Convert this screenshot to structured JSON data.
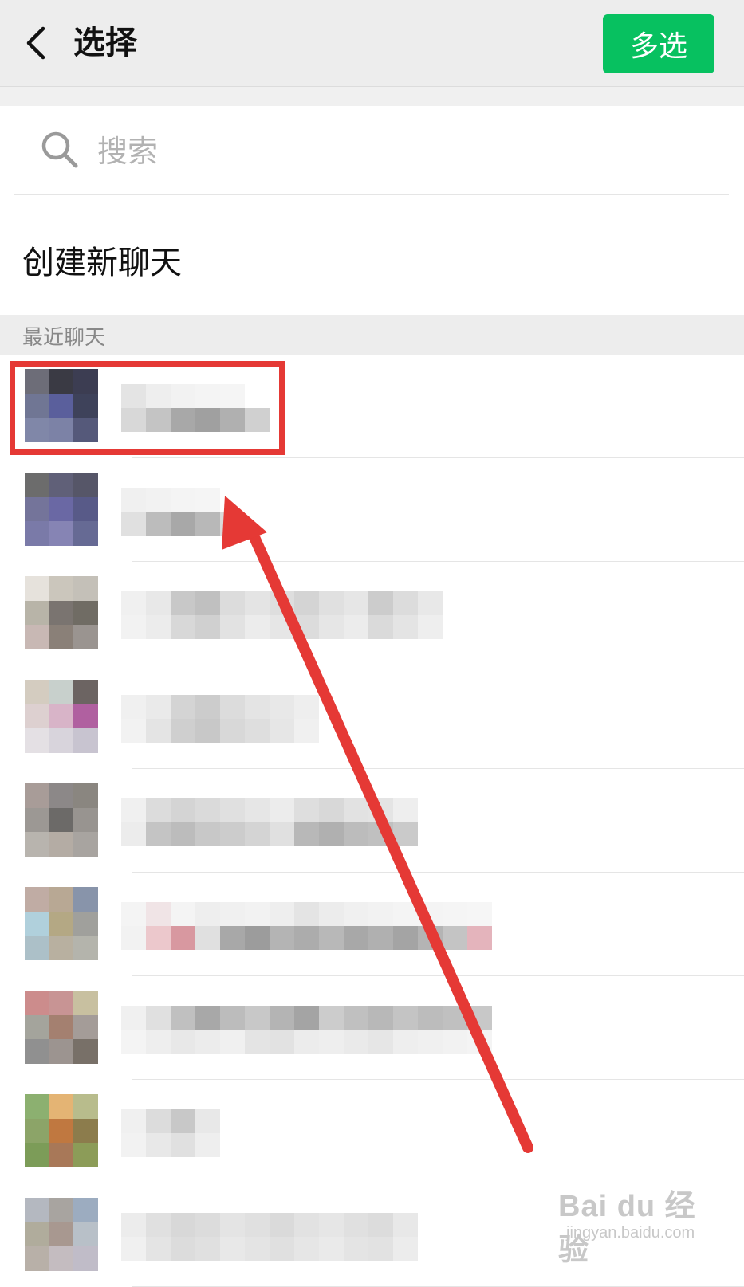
{
  "header": {
    "title": "选择",
    "multi_select_label": "多选"
  },
  "search": {
    "placeholder": "搜索"
  },
  "create_chat_label": "创建新聊天",
  "recent_section_label": "最近聊天",
  "colors": {
    "accent_green": "#07c160",
    "header_bg": "#ededed",
    "highlight_red": "#e53935"
  },
  "watermark": {
    "main": "Bai du 经验",
    "sub": "jingyan.baidu.com"
  },
  "chats": [
    {
      "avatar": [
        "#6d6d78",
        "#3a3a44",
        "#3c3d52",
        "#707694",
        "#5a5f9c",
        "#3e425a",
        "#8087a8",
        "#7c82a6",
        "#55597a"
      ],
      "name_rows": [
        [
          "#e4e4e4",
          "#eeeeee",
          "#f2f2f2",
          "#f4f4f4",
          "#f5f5f5"
        ],
        [
          "#d8d8d8",
          "#c4c4c4",
          "#a8a8a8",
          "#a0a0a0",
          "#b0b0b0",
          "#d0d0d0"
        ]
      ]
    },
    {
      "avatar": [
        "#6c6c6c",
        "#606078",
        "#565668",
        "#74749a",
        "#6a68a4",
        "#585a88",
        "#7a7aa8",
        "#8684b4",
        "#666a94"
      ],
      "name_rows": [
        [
          "#f0f0f0",
          "#f2f2f2",
          "#f4f4f4",
          "#f5f5f5"
        ],
        [
          "#e0e0e0",
          "#bcbcbc",
          "#a8a8a8",
          "#b8b8b8",
          "#dadada"
        ]
      ]
    },
    {
      "avatar": [
        "#e6e2dc",
        "#cbc6bc",
        "#c4c0b8",
        "#b8b4a8",
        "#7a7470",
        "#706c64",
        "#c8b8b4",
        "#8a8078",
        "#9a9490"
      ],
      "name_rows": [
        [
          "#f0f0f0",
          "#e8e8e8",
          "#c8c8c8",
          "#c0c0c0",
          "#dcdcdc",
          "#e4e4e4",
          "#dedede",
          "#d4d4d4",
          "#e0e0e0",
          "#e6e6e6",
          "#cccccc",
          "#dcdcdc",
          "#e8e8e8"
        ],
        [
          "#f2f2f2",
          "#ececec",
          "#d8d8d8",
          "#d0d0d0",
          "#e2e2e2",
          "#ececec",
          "#e6e6e6",
          "#dcdcdc",
          "#e6e6e6",
          "#ececec",
          "#dadada",
          "#e4e4e4",
          "#eeeeee"
        ]
      ]
    },
    {
      "avatar": [
        "#d4ccc0",
        "#c8d0cc",
        "#6c6462",
        "#ddd0d0",
        "#d8b4c8",
        "#b060a0",
        "#e4e0e4",
        "#d8d4dc",
        "#c8c4d0"
      ],
      "name_rows": [
        [
          "#f0f0f0",
          "#eaeaea",
          "#d4d4d4",
          "#cccccc",
          "#dcdcdc",
          "#e4e4e4",
          "#e8e8e8",
          "#eeeeee"
        ],
        [
          "#f2f2f2",
          "#e4e4e4",
          "#cfcfcf",
          "#c8c8c8",
          "#d8d8d8",
          "#dedede",
          "#e6e6e6",
          "#f0f0f0"
        ]
      ]
    },
    {
      "avatar": [
        "#a89c98",
        "#8c8888",
        "#8a8680",
        "#9c9894",
        "#6c6a68",
        "#989490",
        "#b8b4ae",
        "#b4aca4",
        "#a8a4a0"
      ],
      "name_rows": [
        [
          "#f0f0f0",
          "#dcdcdc",
          "#d4d4d4",
          "#dadada",
          "#e0e0e0",
          "#e6e6e6",
          "#ececec",
          "#dedede",
          "#d8d8d8",
          "#e2e2e2",
          "#e4e4e4",
          "#eeeeee"
        ],
        [
          "#ececec",
          "#c4c4c4",
          "#bcbcbc",
          "#c8c8c8",
          "#cccccc",
          "#d4d4d4",
          "#e0e0e0",
          "#b8b8b8",
          "#b0b0b0",
          "#bcbcbc",
          "#c0c0c0",
          "#cacaca"
        ]
      ]
    },
    {
      "avatar": [
        "#c0aca4",
        "#b8a894",
        "#8894aa",
        "#b0d0dc",
        "#b4a884",
        "#a0a09c",
        "#acc0c8",
        "#b8b0a0",
        "#b4b4ac"
      ],
      "name_rows": [
        [
          "#f4f4f4",
          "#f0e4e6",
          "#f4f4f4",
          "#eeeeee",
          "#f0f0f0",
          "#f2f2f2",
          "#eeeeee",
          "#e4e4e4",
          "#ececec",
          "#f0f0f0",
          "#f2f2f2",
          "#f4f4f4",
          "#f4f4f4",
          "#f5f5f5",
          "#f6f6f6"
        ],
        [
          "#f2f2f2",
          "#ecc8cc",
          "#d898a0",
          "#e0e0e0",
          "#a8a8a8",
          "#9c9c9c",
          "#b4b4b4",
          "#acacac",
          "#b8b8b8",
          "#a8a8a8",
          "#b0b0b0",
          "#a4a4a4",
          "#b4b4b4",
          "#c4c4c4",
          "#e4b4bc"
        ]
      ]
    },
    {
      "avatar": [
        "#cc8c8c",
        "#c89494",
        "#c8c0a0",
        "#a4a49c",
        "#a48070",
        "#a49c98",
        "#909090",
        "#9c9490",
        "#787068"
      ],
      "name_rows": [
        [
          "#f0f0f0",
          "#e0e0e0",
          "#c0c0c0",
          "#a8a8a8",
          "#bcbcbc",
          "#c8c8c8",
          "#b4b4b4",
          "#a4a4a4",
          "#cccccc",
          "#c0c0c0",
          "#b8b8b8",
          "#c4c4c4",
          "#bcbcbc",
          "#c0c0c0",
          "#c8c8c8"
        ],
        [
          "#f4f4f4",
          "#eeeeee",
          "#e8e8e8",
          "#ececec",
          "#f0f0f0",
          "#e4e4e4",
          "#e2e2e2",
          "#ececec",
          "#eeeeee",
          "#eaeaea",
          "#e6e6e6",
          "#eeeeee",
          "#f0f0f0",
          "#f2f2f2",
          "#f4f4f4"
        ]
      ]
    },
    {
      "avatar": [
        "#8cb070",
        "#e4b474",
        "#b8bc8c",
        "#8ca468",
        "#c07840",
        "#8c7c4c",
        "#7c9c58",
        "#a87858",
        "#8c9c58"
      ],
      "name_rows": [
        [
          "#f0f0f0",
          "#dcdcdc",
          "#c8c8c8",
          "#e8e8e8"
        ],
        [
          "#f2f2f2",
          "#e8e8e8",
          "#e0e0e0",
          "#eeeeee"
        ]
      ]
    },
    {
      "avatar": [
        "#b4b8c0",
        "#a8a4a0",
        "#9cacc0",
        "#b0ac9c",
        "#a89890",
        "#b8c0c8",
        "#b8b0a8",
        "#c4bcc0",
        "#c0bcc8"
      ],
      "name_rows": [
        [
          "#ececec",
          "#e0e0e0",
          "#d8d8d8",
          "#dcdcdc",
          "#e4e4e4",
          "#e0e0e0",
          "#dadada",
          "#e2e2e2",
          "#e6e6e6",
          "#e0e0e0",
          "#dcdcdc",
          "#e8e8e8"
        ],
        [
          "#f0f0f0",
          "#e4e4e4",
          "#dcdcdc",
          "#e0e0e0",
          "#e8e8e8",
          "#e4e4e4",
          "#e0e0e0",
          "#e6e6e6",
          "#eaeaea",
          "#e4e4e4",
          "#e2e2e2",
          "#ececec"
        ]
      ]
    }
  ]
}
